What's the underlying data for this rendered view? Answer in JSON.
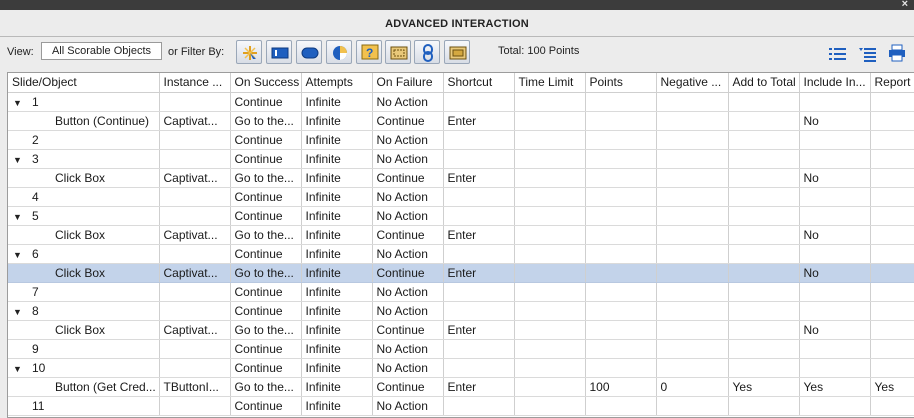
{
  "window": {
    "title": "ADVANCED INTERACTION",
    "close_glyph": "×"
  },
  "toolbar": {
    "view_label": "View:",
    "view_value": "All Scorable Objects",
    "filter_label": "or Filter By:",
    "filter_icons": [
      "button-filter-icon",
      "text-entry-filter-icon",
      "shape-filter-icon",
      "quiz-filter-icon",
      "question-filter-icon",
      "click-box-filter-icon",
      "link-filter-icon",
      "widget-filter-icon"
    ],
    "total_text": "Total: 100 Points"
  },
  "columns": [
    "Slide/Object",
    "Instance ...",
    "On Success",
    "Attempts",
    "On Failure",
    "Shortcut",
    "Time Limit",
    "Points",
    "Negative ...",
    "Add to Total",
    "Include In...",
    "Report"
  ],
  "rows": [
    {
      "type": "slide",
      "toggle": "▼",
      "cells": [
        "1",
        "",
        "Continue",
        "Infinite",
        "No Action",
        "",
        "",
        "",
        "",
        "",
        "",
        ""
      ]
    },
    {
      "type": "child",
      "cells": [
        "Button (Continue)",
        "Captivat...",
        "Go to the...",
        "Infinite",
        "Continue",
        "Enter",
        "",
        "",
        "",
        "",
        "No",
        ""
      ]
    },
    {
      "type": "slide",
      "toggle": "",
      "cells": [
        "2",
        "",
        "Continue",
        "Infinite",
        "No Action",
        "",
        "",
        "",
        "",
        "",
        "",
        ""
      ]
    },
    {
      "type": "slide",
      "toggle": "▼",
      "cells": [
        "3",
        "",
        "Continue",
        "Infinite",
        "No Action",
        "",
        "",
        "",
        "",
        "",
        "",
        ""
      ]
    },
    {
      "type": "child",
      "cells": [
        "Click Box",
        "Captivat...",
        "Go to the...",
        "Infinite",
        "Continue",
        "Enter",
        "",
        "",
        "",
        "",
        "No",
        ""
      ]
    },
    {
      "type": "slide",
      "toggle": "",
      "cells": [
        "4",
        "",
        "Continue",
        "Infinite",
        "No Action",
        "",
        "",
        "",
        "",
        "",
        "",
        ""
      ]
    },
    {
      "type": "slide",
      "toggle": "▼",
      "cells": [
        "5",
        "",
        "Continue",
        "Infinite",
        "No Action",
        "",
        "",
        "",
        "",
        "",
        "",
        ""
      ]
    },
    {
      "type": "child",
      "cells": [
        "Click Box",
        "Captivat...",
        "Go to the...",
        "Infinite",
        "Continue",
        "Enter",
        "",
        "",
        "",
        "",
        "No",
        ""
      ]
    },
    {
      "type": "slide",
      "toggle": "▼",
      "cells": [
        "6",
        "",
        "Continue",
        "Infinite",
        "No Action",
        "",
        "",
        "",
        "",
        "",
        "",
        ""
      ]
    },
    {
      "type": "child",
      "selected": true,
      "cells": [
        "Click Box",
        "Captivat...",
        "Go to the...",
        "Infinite",
        "Continue",
        "Enter",
        "",
        "",
        "",
        "",
        "No",
        ""
      ]
    },
    {
      "type": "slide",
      "toggle": "",
      "cells": [
        "7",
        "",
        "Continue",
        "Infinite",
        "No Action",
        "",
        "",
        "",
        "",
        "",
        "",
        ""
      ]
    },
    {
      "type": "slide",
      "toggle": "▼",
      "cells": [
        "8",
        "",
        "Continue",
        "Infinite",
        "No Action",
        "",
        "",
        "",
        "",
        "",
        "",
        ""
      ]
    },
    {
      "type": "child",
      "cells": [
        "Click Box",
        "Captivat...",
        "Go to the...",
        "Infinite",
        "Continue",
        "Enter",
        "",
        "",
        "",
        "",
        "No",
        ""
      ]
    },
    {
      "type": "slide",
      "toggle": "",
      "cells": [
        "9",
        "",
        "Continue",
        "Infinite",
        "No Action",
        "",
        "",
        "",
        "",
        "",
        "",
        ""
      ]
    },
    {
      "type": "slide",
      "toggle": "▼",
      "cells": [
        "10",
        "",
        "Continue",
        "Infinite",
        "No Action",
        "",
        "",
        "",
        "",
        "",
        "",
        ""
      ]
    },
    {
      "type": "child",
      "cells": [
        "Button (Get Cred...",
        "TButtonI...",
        "Go to the...",
        "Infinite",
        "Continue",
        "Enter",
        "",
        "100",
        "0",
        "Yes",
        "Yes",
        "Yes"
      ]
    },
    {
      "type": "slide",
      "toggle": "",
      "cells": [
        "11",
        "",
        "Continue",
        "Infinite",
        "No Action",
        "",
        "",
        "",
        "",
        "",
        "",
        ""
      ]
    }
  ],
  "colors": {
    "selected_row": "#c3d3ea",
    "accent": "#1f5fbf"
  }
}
